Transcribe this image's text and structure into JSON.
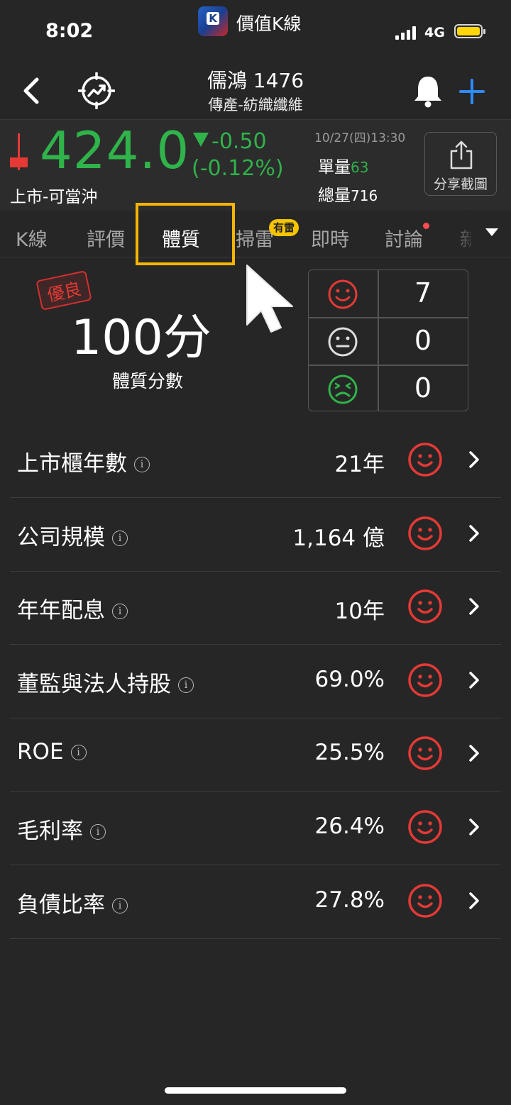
{
  "status_bar": {
    "time": "8:02",
    "app_name": "價值K線",
    "app_logo_letter": "K",
    "network": "4G"
  },
  "header": {
    "stock_name": "儒鴻 1476",
    "sector": "傳產-紡織纖維"
  },
  "quote": {
    "price": "424.0",
    "change": "-0.50",
    "change_pct": "(-0.12%)",
    "market": "上市-可當沖",
    "time": "10/27(四)13:30",
    "single_volume_label": "單量",
    "single_volume": "63",
    "total_volume_label": "總量",
    "total_volume": "716",
    "share_label": "分享截圖"
  },
  "tabs": [
    {
      "label": "K線"
    },
    {
      "label": "評價"
    },
    {
      "label": "體質"
    },
    {
      "label": "掃雷"
    },
    {
      "label": "即時"
    },
    {
      "label": "討論"
    },
    {
      "label": "新"
    }
  ],
  "tab_badge": "有雷",
  "score": {
    "grade": "優良",
    "value": "100分",
    "label": "體質分數"
  },
  "face_counts": {
    "good": "7",
    "neutral": "0",
    "bad": "0"
  },
  "metrics": [
    {
      "label": "上市櫃年數",
      "value": "21年",
      "rating": "good"
    },
    {
      "label": "公司規模",
      "value": "1,164 億",
      "rating": "good"
    },
    {
      "label": "年年配息",
      "value": "10年",
      "rating": "good"
    },
    {
      "label": "董監與法人持股",
      "value": "69.0%",
      "rating": "good"
    },
    {
      "label": "ROE",
      "value": "25.5%",
      "rating": "good"
    },
    {
      "label": "毛利率",
      "value": "26.4%",
      "rating": "good"
    },
    {
      "label": "負債比率",
      "value": "27.8%",
      "rating": "good"
    }
  ],
  "info_glyph": "i",
  "colors": {
    "up_red": "#e53935",
    "down_green": "#2fb34a",
    "highlight": "#f5b400",
    "accent_blue": "#2d8cff"
  }
}
